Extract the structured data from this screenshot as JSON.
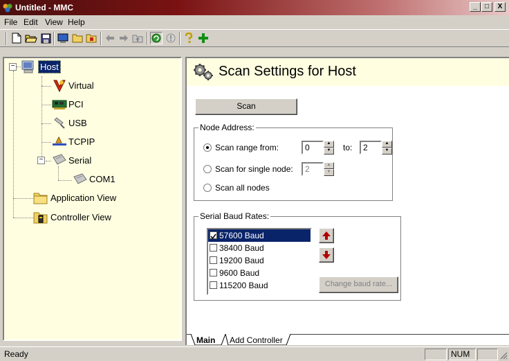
{
  "window": {
    "title": "Untitled - MMC",
    "minimize": "_",
    "restore": "□",
    "close": "X"
  },
  "menu": {
    "items": [
      "File",
      "Edit",
      "View",
      "Help"
    ]
  },
  "toolbar": {
    "icons": [
      "new-document-icon",
      "open-folder-icon",
      "save-icon",
      "console-icon",
      "folder-icon",
      "folder-alt-icon",
      "back-arrow-icon",
      "forward-arrow-icon",
      "up-level-icon",
      "refresh-icon",
      "stop-icon",
      "help-icon",
      "add-icon"
    ]
  },
  "tree": {
    "items": [
      {
        "label": "Host",
        "icon": "host-icon",
        "selected": true
      },
      {
        "label": "Virtual",
        "icon": "virtual-icon"
      },
      {
        "label": "PCI",
        "icon": "pci-card-icon"
      },
      {
        "label": "USB",
        "icon": "usb-plug-icon"
      },
      {
        "label": "TCPIP",
        "icon": "network-icon"
      },
      {
        "label": "Serial",
        "icon": "serial-connector-icon"
      },
      {
        "label": "COM1",
        "icon": "serial-connector-icon"
      },
      {
        "label": "Application View",
        "icon": "folder-icon"
      },
      {
        "label": "Controller View",
        "icon": "folder-controller-icon"
      }
    ],
    "expander_minus": "−"
  },
  "main": {
    "title": "Scan Settings for Host",
    "scan_button": "Scan",
    "node_address": {
      "legend": "Node Address:",
      "range_label": "Scan range from:",
      "range_from": "0",
      "to_label": "to:",
      "range_to": "2",
      "single_label": "Scan for single node:",
      "single_value": "2",
      "all_label": "Scan all nodes",
      "selected": "range"
    },
    "baud": {
      "legend": "Serial Baud Rates:",
      "items": [
        {
          "label": "57600 Baud",
          "checked": true,
          "selected": true
        },
        {
          "label": "38400 Baud",
          "checked": false
        },
        {
          "label": "19200 Baud",
          "checked": false
        },
        {
          "label": "9600 Baud",
          "checked": false
        },
        {
          "label": "115200 Baud",
          "checked": false
        }
      ],
      "change_button": "Change baud rate..."
    },
    "tabs": [
      "Main",
      "Add Controller"
    ],
    "active_tab": "Main"
  },
  "status": {
    "text": "Ready",
    "num": "NUM"
  },
  "colors": {
    "pane_bg": "#fffee1",
    "selection": "#0a246a",
    "arrow_red": "#b00000"
  }
}
